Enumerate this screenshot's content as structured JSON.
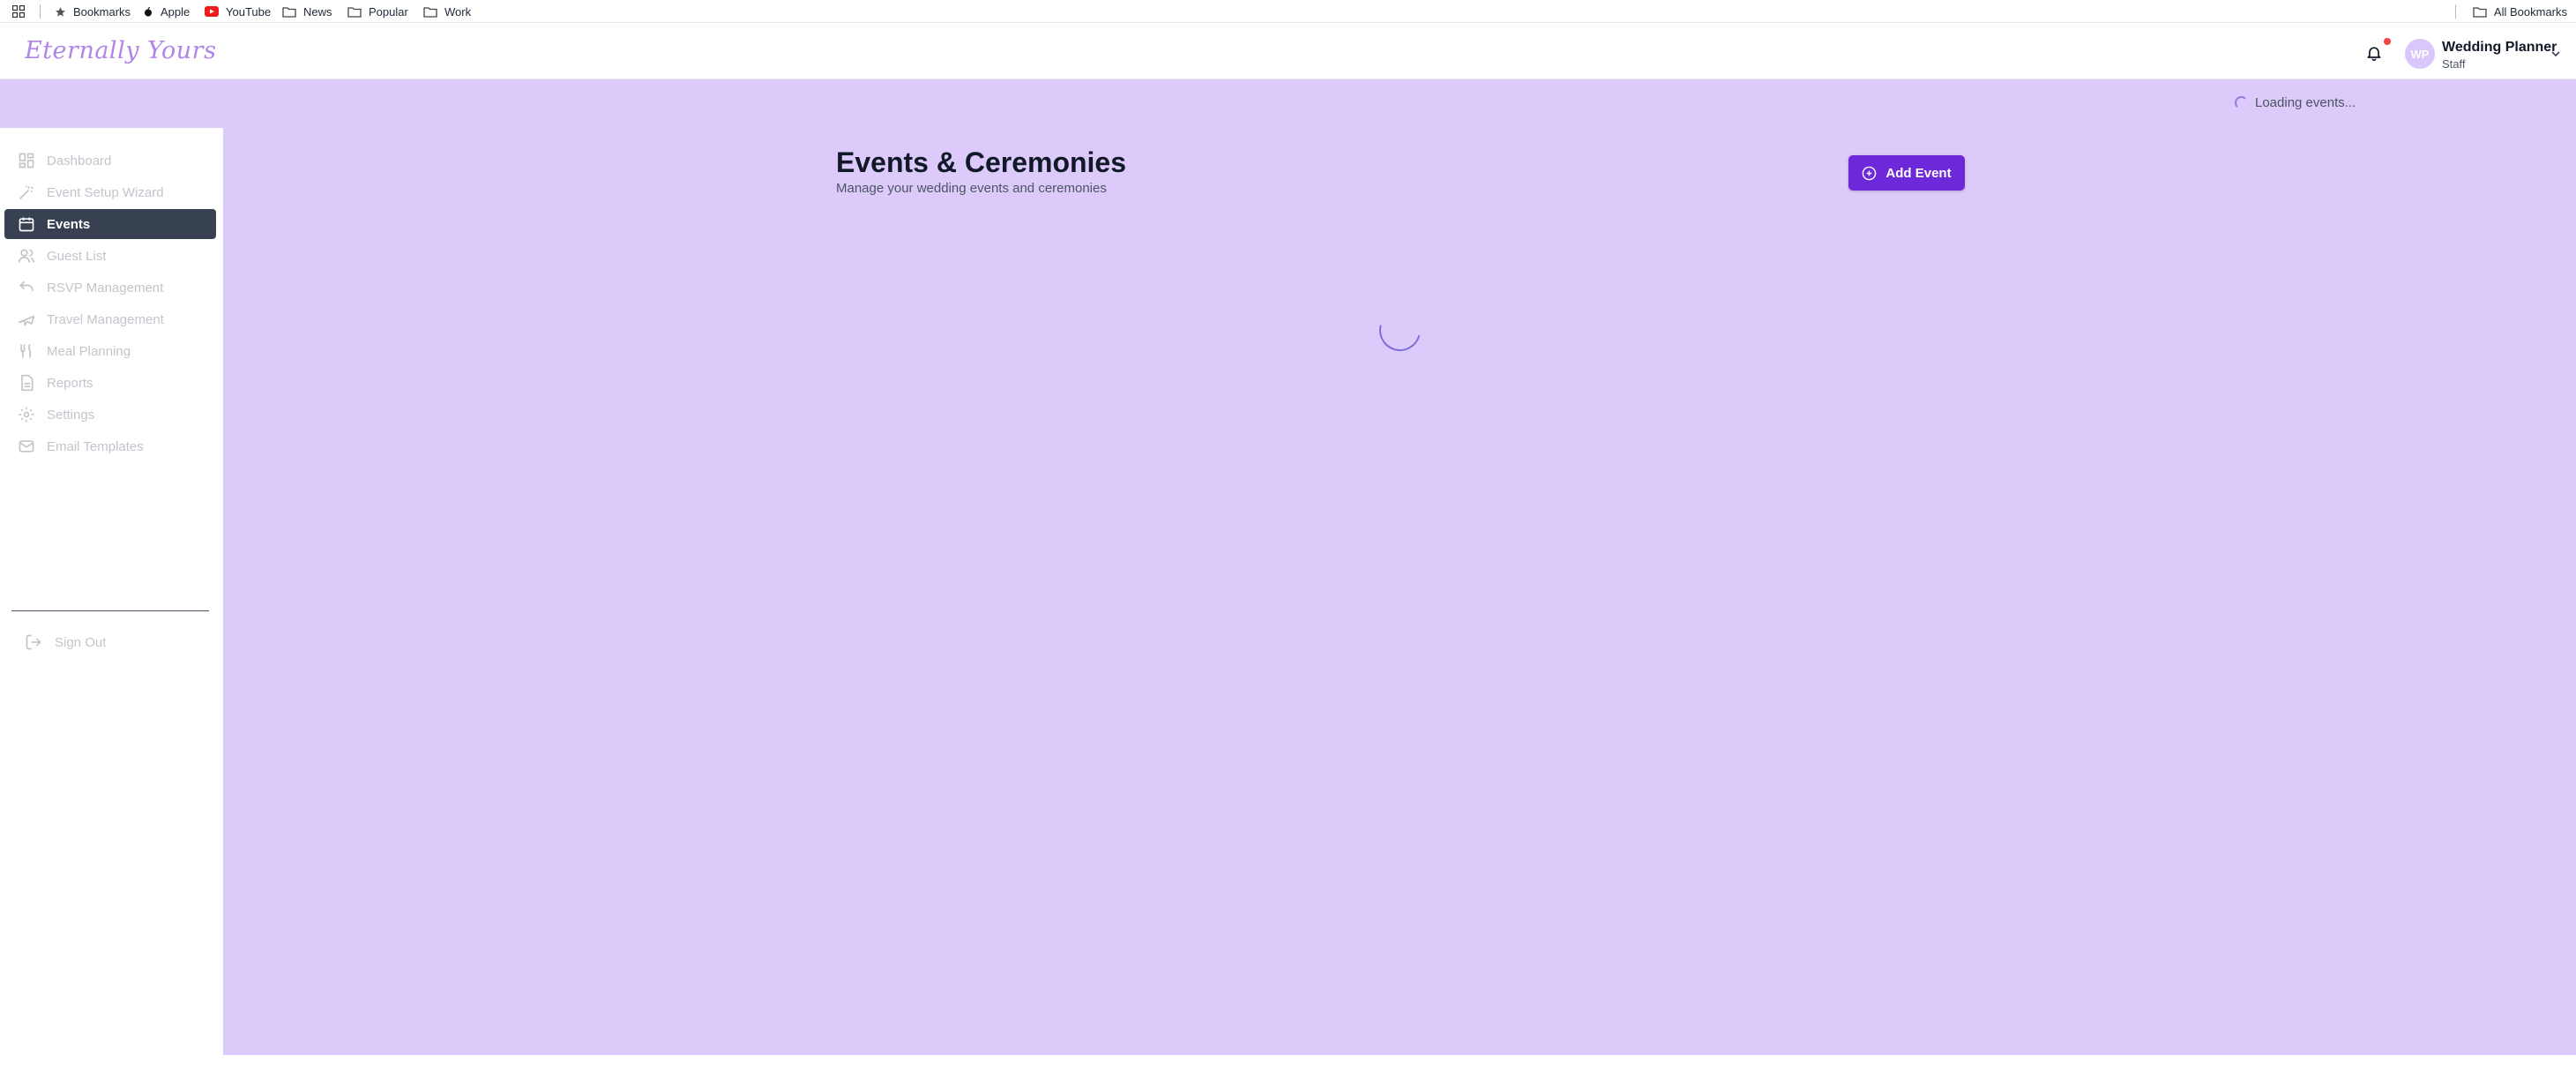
{
  "bookmarks_bar": {
    "items": [
      {
        "label": "Bookmarks",
        "icon": "star-icon"
      },
      {
        "label": "Apple",
        "icon": "apple-icon"
      },
      {
        "label": "YouTube",
        "icon": "youtube-icon"
      },
      {
        "label": "News",
        "icon": "folder-icon"
      },
      {
        "label": "Popular",
        "icon": "folder-icon"
      },
      {
        "label": "Work",
        "icon": "folder-icon"
      }
    ],
    "all_bookmarks": "All Bookmarks"
  },
  "header": {
    "logo": "Eternally Yours",
    "user": {
      "initials": "WP",
      "name": "Wedding Planner",
      "role": "Staff"
    }
  },
  "status": {
    "loading_text": "Loading events..."
  },
  "sidebar": {
    "items": [
      {
        "label": "Dashboard",
        "icon": "grid-icon",
        "active": false
      },
      {
        "label": "Event Setup Wizard",
        "icon": "wand-icon",
        "active": false
      },
      {
        "label": "Events",
        "icon": "calendar-icon",
        "active": true
      },
      {
        "label": "Guest List",
        "icon": "users-icon",
        "active": false
      },
      {
        "label": "RSVP Management",
        "icon": "reply-icon",
        "active": false
      },
      {
        "label": "Travel Management",
        "icon": "plane-icon",
        "active": false
      },
      {
        "label": "Meal Planning",
        "icon": "utensils-icon",
        "active": false
      },
      {
        "label": "Reports",
        "icon": "report-icon",
        "active": false
      },
      {
        "label": "Settings",
        "icon": "gear-icon",
        "active": false
      },
      {
        "label": "Email Templates",
        "icon": "mail-icon",
        "active": false
      }
    ],
    "sign_out": "Sign Out"
  },
  "main": {
    "title": "Events & Ceremonies",
    "subtitle": "Manage your wedding events and ceremonies",
    "add_button": "Add Event"
  },
  "colors": {
    "accent": "#6d28d9",
    "background": "#dccbfa",
    "sidebar_active": "#374151",
    "logo": "#b084e8",
    "notification_dot": "#ef4444"
  }
}
